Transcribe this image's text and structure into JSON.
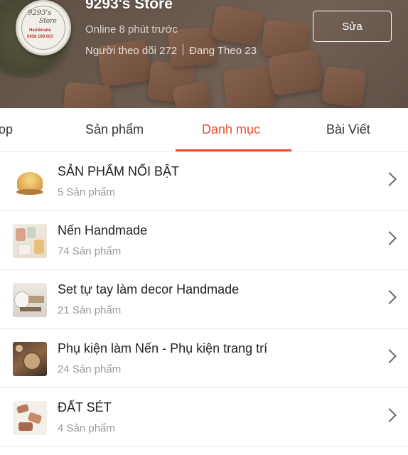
{
  "store": {
    "name": "9293's Store",
    "online": "Online 8 phút trước",
    "followers": "Người theo dõi 272",
    "following": "Đang Theo 23",
    "edit_label": "Sửa",
    "logo": {
      "line1": "9293's",
      "line2": "Store",
      "red_line": "Handmade",
      "phone": "0938 198 003"
    }
  },
  "tabs": [
    {
      "label": "op",
      "active": false
    },
    {
      "label": "Sản phẩm",
      "active": false
    },
    {
      "label": "Danh mục",
      "active": true
    },
    {
      "label": "Bài Viết",
      "active": false
    }
  ],
  "categories": [
    {
      "title": "SẢN PHẨM NỔI BẬT",
      "count": "5 Sản phẩm"
    },
    {
      "title": "Nến Handmade",
      "count": "74 Sản phẩm"
    },
    {
      "title": "Set tự tay làm decor Handmade",
      "count": "21 Sản phẩm"
    },
    {
      "title": "Phụ kiện làm Nến - Phụ kiện trang trí",
      "count": "24 Sản phẩm"
    },
    {
      "title": "ĐẤT SÉT",
      "count": "4 Sản phẩm"
    }
  ],
  "colors": {
    "accent": "#ee4d2d",
    "muted_text": "#9a9a9a"
  },
  "icons": {
    "row_arrow": "chevron-right-icon"
  }
}
